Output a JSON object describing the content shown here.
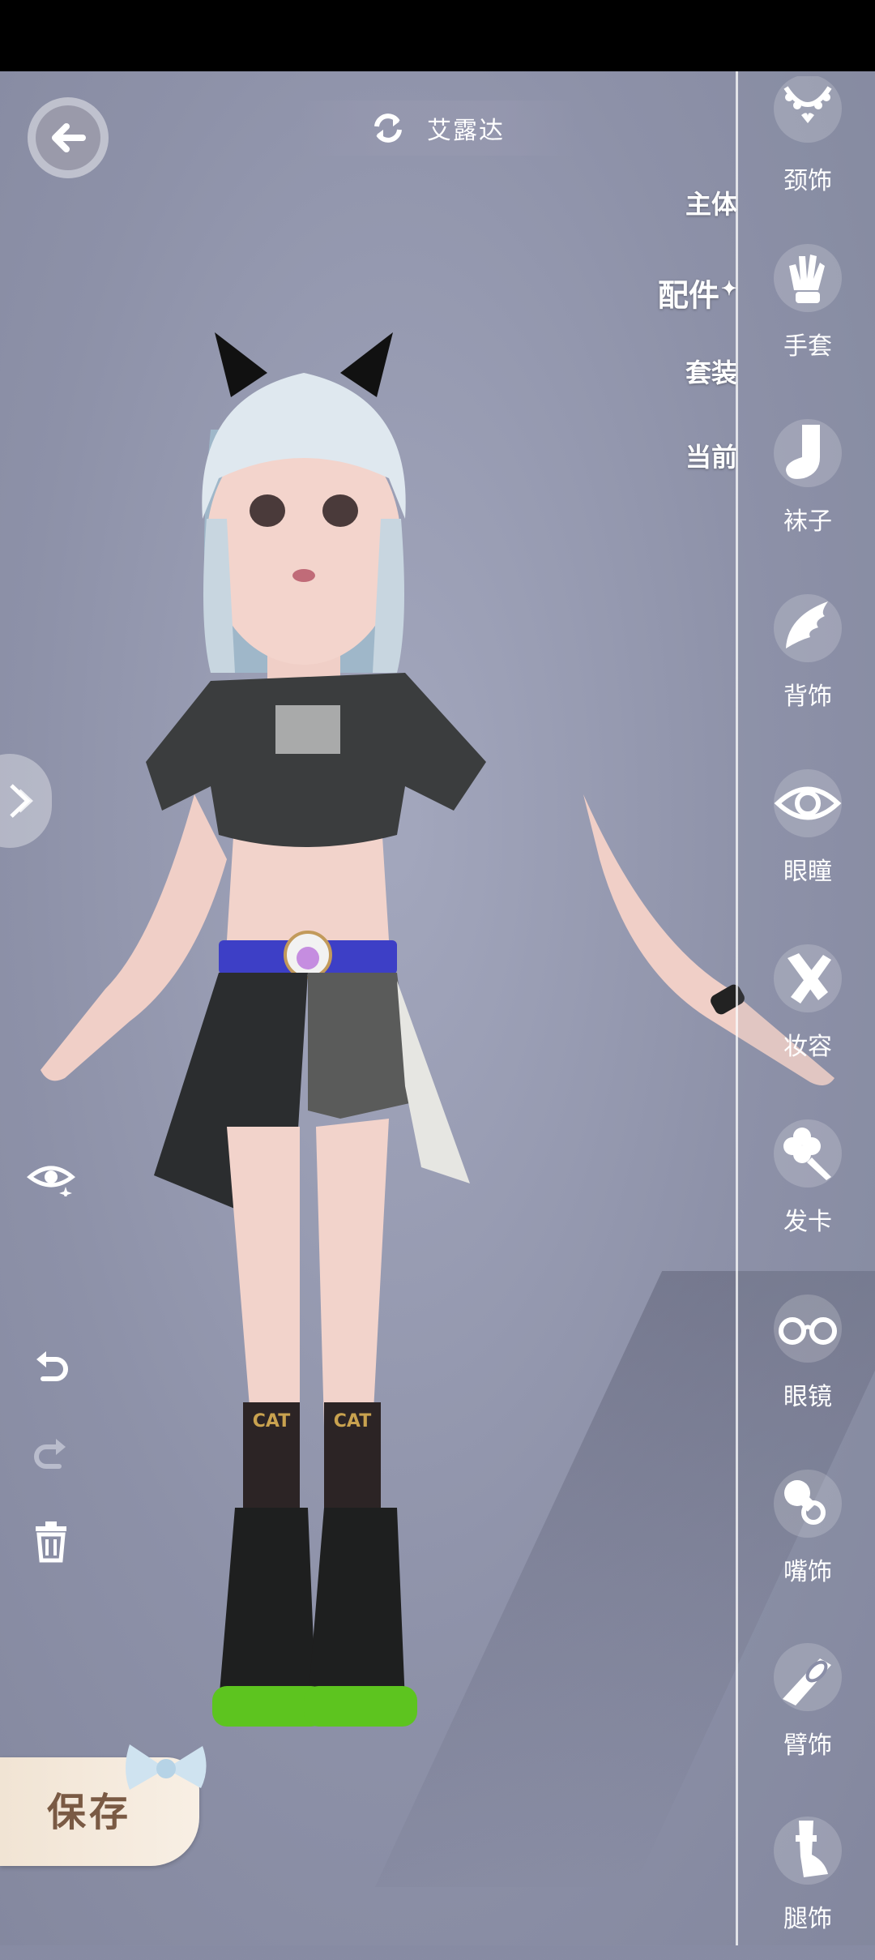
{
  "header": {
    "character_name": "艾露达"
  },
  "category_tabs": [
    {
      "label": "主体"
    },
    {
      "label": "配件",
      "active": true,
      "mark": "✦"
    },
    {
      "label": "套装"
    },
    {
      "label": "当前"
    }
  ],
  "sidebar": {
    "items": [
      {
        "label": "颈饰",
        "icon": "necklace-icon"
      },
      {
        "label": "手套",
        "icon": "glove-icon"
      },
      {
        "label": "袜子",
        "icon": "sock-icon"
      },
      {
        "label": "背饰",
        "icon": "wing-icon"
      },
      {
        "label": "眼瞳",
        "icon": "eye-icon"
      },
      {
        "label": "妆容",
        "icon": "makeup-icon"
      },
      {
        "label": "发卡",
        "icon": "flower-clip-icon"
      },
      {
        "label": "眼镜",
        "icon": "glasses-icon"
      },
      {
        "label": "嘴饰",
        "icon": "pacifier-icon"
      },
      {
        "label": "臂饰",
        "icon": "armband-icon"
      },
      {
        "label": "腿饰",
        "icon": "leg-icon"
      }
    ]
  },
  "toolbar": {
    "save_label": "保存"
  },
  "model": {
    "belt_text": "",
    "sock_text": "CAT"
  },
  "colors": {
    "accent": "#ffffff",
    "save_text": "#7a5a44",
    "boot_sole": "#5dc41f"
  }
}
